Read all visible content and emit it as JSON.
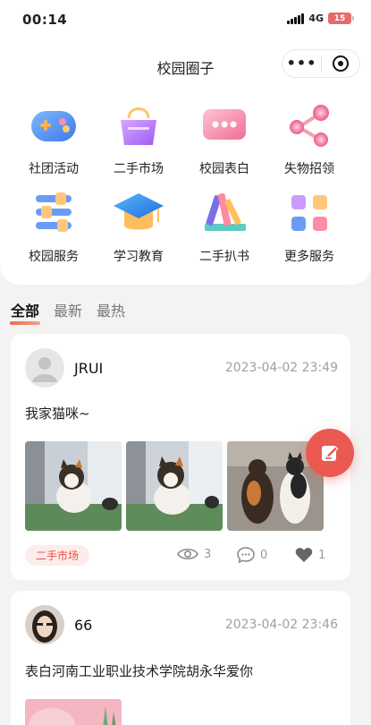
{
  "status_bar": {
    "time": "00:14",
    "network": "4G",
    "battery": "15"
  },
  "header": {
    "title": "校园圈子",
    "menu_icon": "more-dots-icon",
    "close_icon": "target-icon"
  },
  "categories": [
    {
      "label": "社团活动",
      "icon": "gamepad-icon"
    },
    {
      "label": "二手市场",
      "icon": "shopping-bag-icon"
    },
    {
      "label": "校园表白",
      "icon": "chat-bubble-icon"
    },
    {
      "label": "失物招领",
      "icon": "share-nodes-icon"
    },
    {
      "label": "校园服务",
      "icon": "list-menu-icon"
    },
    {
      "label": "学习教育",
      "icon": "graduation-cap-icon"
    },
    {
      "label": "二手扒书",
      "icon": "books-icon"
    },
    {
      "label": "更多服务",
      "icon": "grid-icon"
    }
  ],
  "tabs": [
    {
      "label": "全部",
      "active": true
    },
    {
      "label": "最新",
      "active": false
    },
    {
      "label": "最热",
      "active": false
    }
  ],
  "posts": [
    {
      "username": "JRUI",
      "time": "2023-04-02 23:49",
      "text": "我家猫咪~",
      "tag": "二手市场",
      "views": "3",
      "comments": "0",
      "likes": "1"
    },
    {
      "username": "66",
      "time": "2023-04-02 23:46",
      "text": "表白河南工业职业技术学院胡永华爱你"
    }
  ],
  "colors": {
    "accent": "#ea5a52",
    "tag_bg": "#fdeceb",
    "tag_text": "#e5553d"
  }
}
